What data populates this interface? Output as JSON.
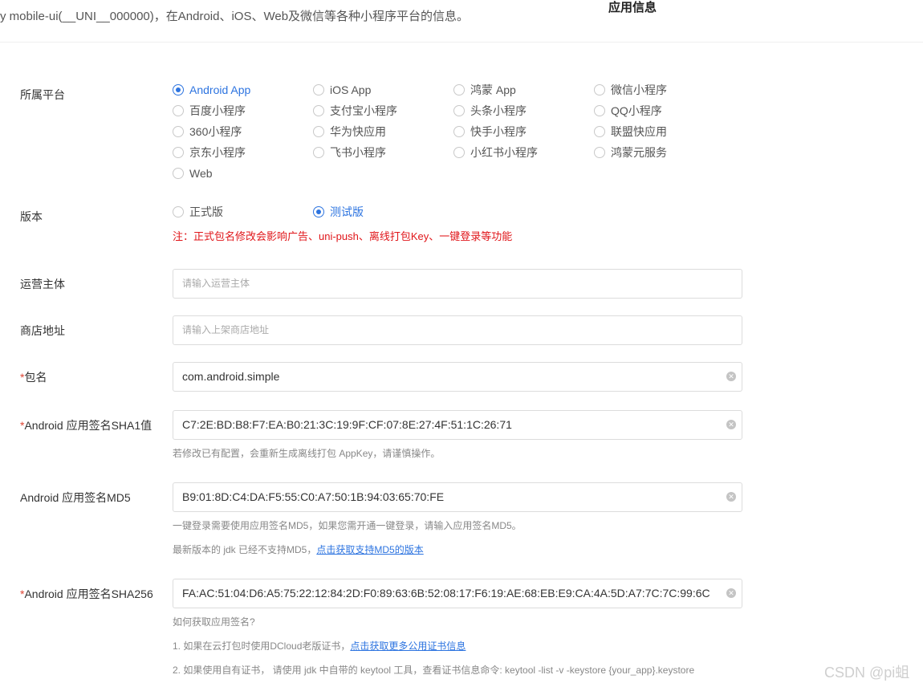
{
  "header": {
    "description_fragment": "y mobile-ui(__UNI__000000)，在Android、iOS、Web及微信等各种小程序平台的信息。",
    "title": "应用信息"
  },
  "platform": {
    "label": "所属平台",
    "selected": "Android App",
    "options": [
      "Android App",
      "iOS App",
      "鸿蒙 App",
      "微信小程序",
      "百度小程序",
      "支付宝小程序",
      "头条小程序",
      "QQ小程序",
      "360小程序",
      "华为快应用",
      "快手小程序",
      "联盟快应用",
      "京东小程序",
      "飞书小程序",
      "小红书小程序",
      "鸿蒙元服务",
      "Web"
    ]
  },
  "version": {
    "label": "版本",
    "options": [
      "正式版",
      "测试版"
    ],
    "selected": "测试版",
    "note": "注：正式包名修改会影响广告、uni-push、离线打包Key、一键登录等功能"
  },
  "operator": {
    "label": "运营主体",
    "placeholder": "请输入运营主体"
  },
  "store": {
    "label": "商店地址",
    "placeholder": "请输入上架商店地址"
  },
  "package": {
    "required": "*",
    "label": "包名",
    "value": "com.android.simple"
  },
  "sha1": {
    "required": "*",
    "label": "Android 应用签名SHA1值",
    "value": "C7:2E:BD:B8:F7:EA:B0:21:3C:19:9F:CF:07:8E:27:4F:51:1C:26:71",
    "help": "若修改已有配置，会重新生成离线打包 AppKey，请谨慎操作。"
  },
  "md5": {
    "label": "Android 应用签名MD5",
    "value": "B9:01:8D:C4:DA:F5:55:C0:A7:50:1B:94:03:65:70:FE",
    "help1": "一键登录需要使用应用签名MD5，如果您需开通一键登录，请输入应用签名MD5。",
    "help2_prefix": "最新版本的 jdk 已经不支持MD5，",
    "help2_link": "点击获取支持MD5的版本"
  },
  "sha256": {
    "required": "*",
    "label": "Android 应用签名SHA256",
    "value": "FA:AC:51:04:D6:A5:75:22:12:84:2D:F0:89:63:6B:52:08:17:F6:19:AE:68:EB:E9:CA:4A:5D:A7:7C:7C:99:6C",
    "help_title": "如何获取应用签名?",
    "help1_prefix": "1. 如果在云打包时使用DCloud老版证书，",
    "help1_link": "点击获取更多公用证书信息",
    "help2": "2. 如果使用自有证书， 请使用 jdk 中自带的 keytool 工具，查看证书信息命令: keytool -list -v -keystore {your_app}.keystore"
  },
  "watermark": "CSDN @pi蛆",
  "colors": {
    "accent": "#2d74e0",
    "warning": "#e0161a",
    "required": "#dd4433"
  }
}
